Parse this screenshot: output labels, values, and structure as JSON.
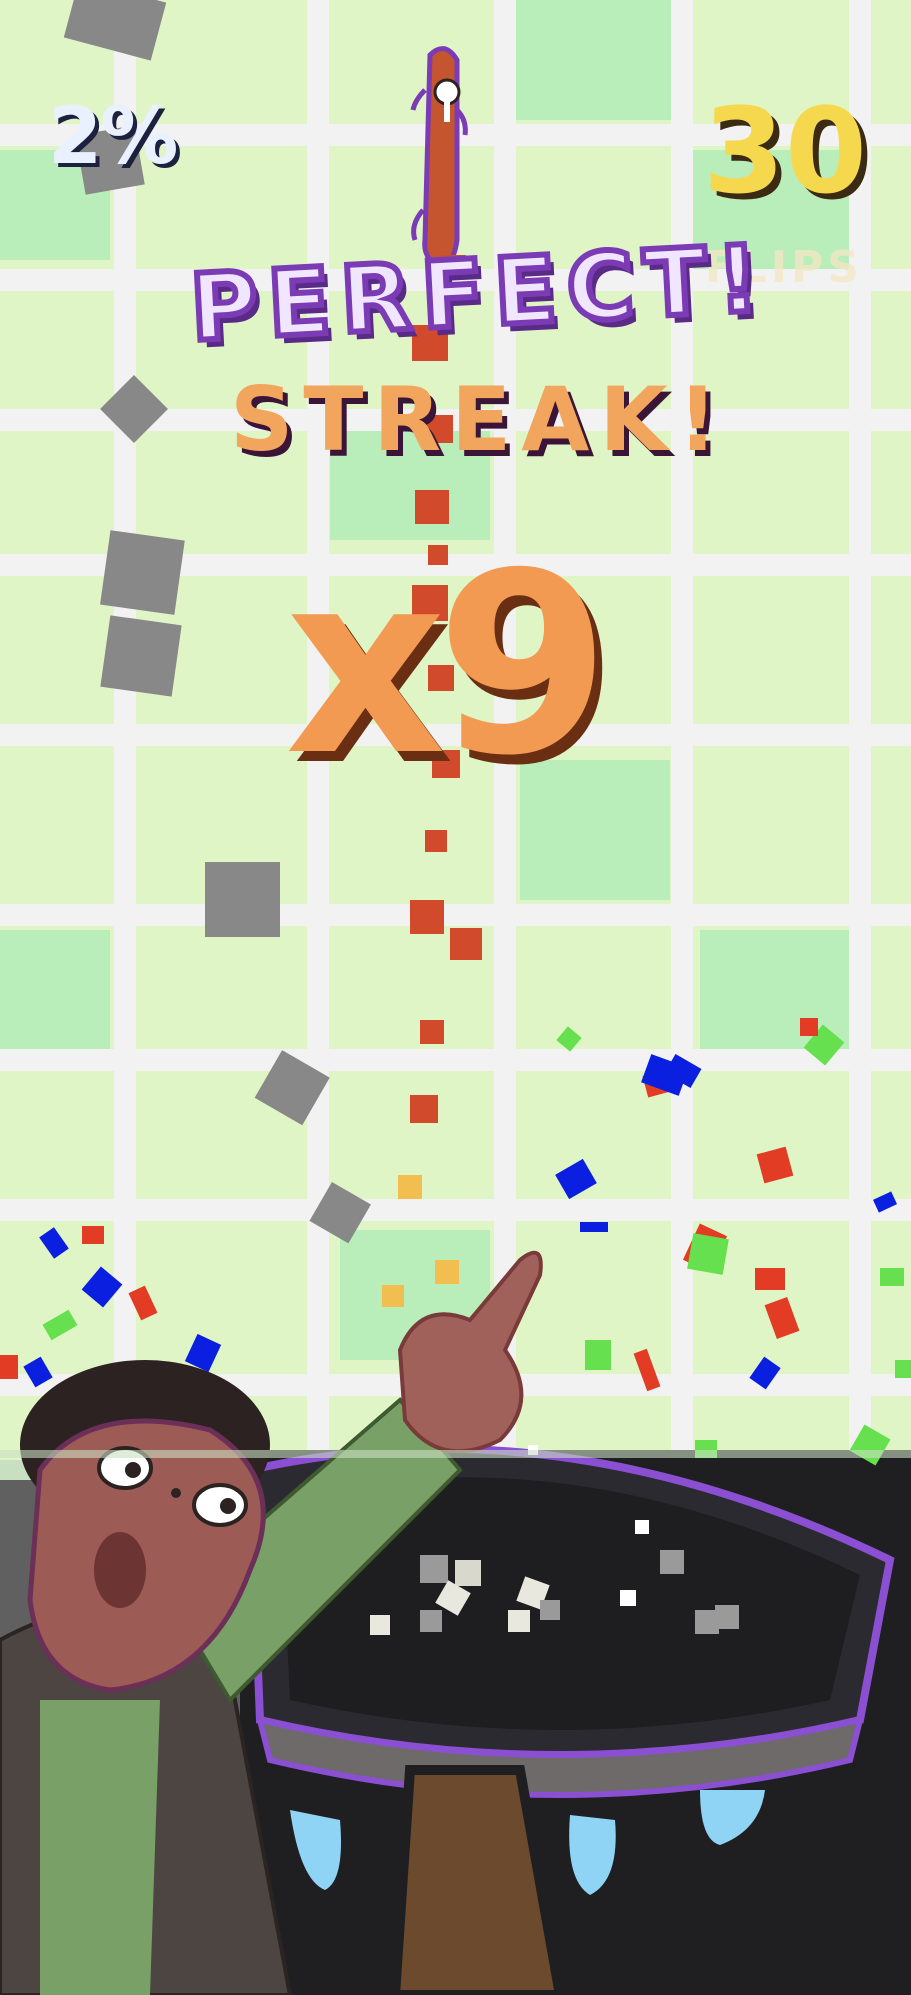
{
  "hud": {
    "progress_text": "2%",
    "flip_count": "30",
    "flips_label": "FLIPS"
  },
  "feedback": {
    "perfect_text": "PERFECT!",
    "streak_text": "STREAK!",
    "multiplier_text": "x9"
  },
  "colors": {
    "background_tile": "#dff5c6",
    "grid_line": "#f3f3f3",
    "pan": "#2d2c31",
    "pan_rim": "#8b4fd1",
    "accent_orange": "#f29a52",
    "score_yellow": "#f6d84f",
    "purple": "#7b3bb5"
  },
  "icons": {
    "sausage": "sausage-character-icon",
    "chef": "chef-character-icon",
    "pan": "frying-pan-icon",
    "flame": "gas-flame-icon"
  }
}
